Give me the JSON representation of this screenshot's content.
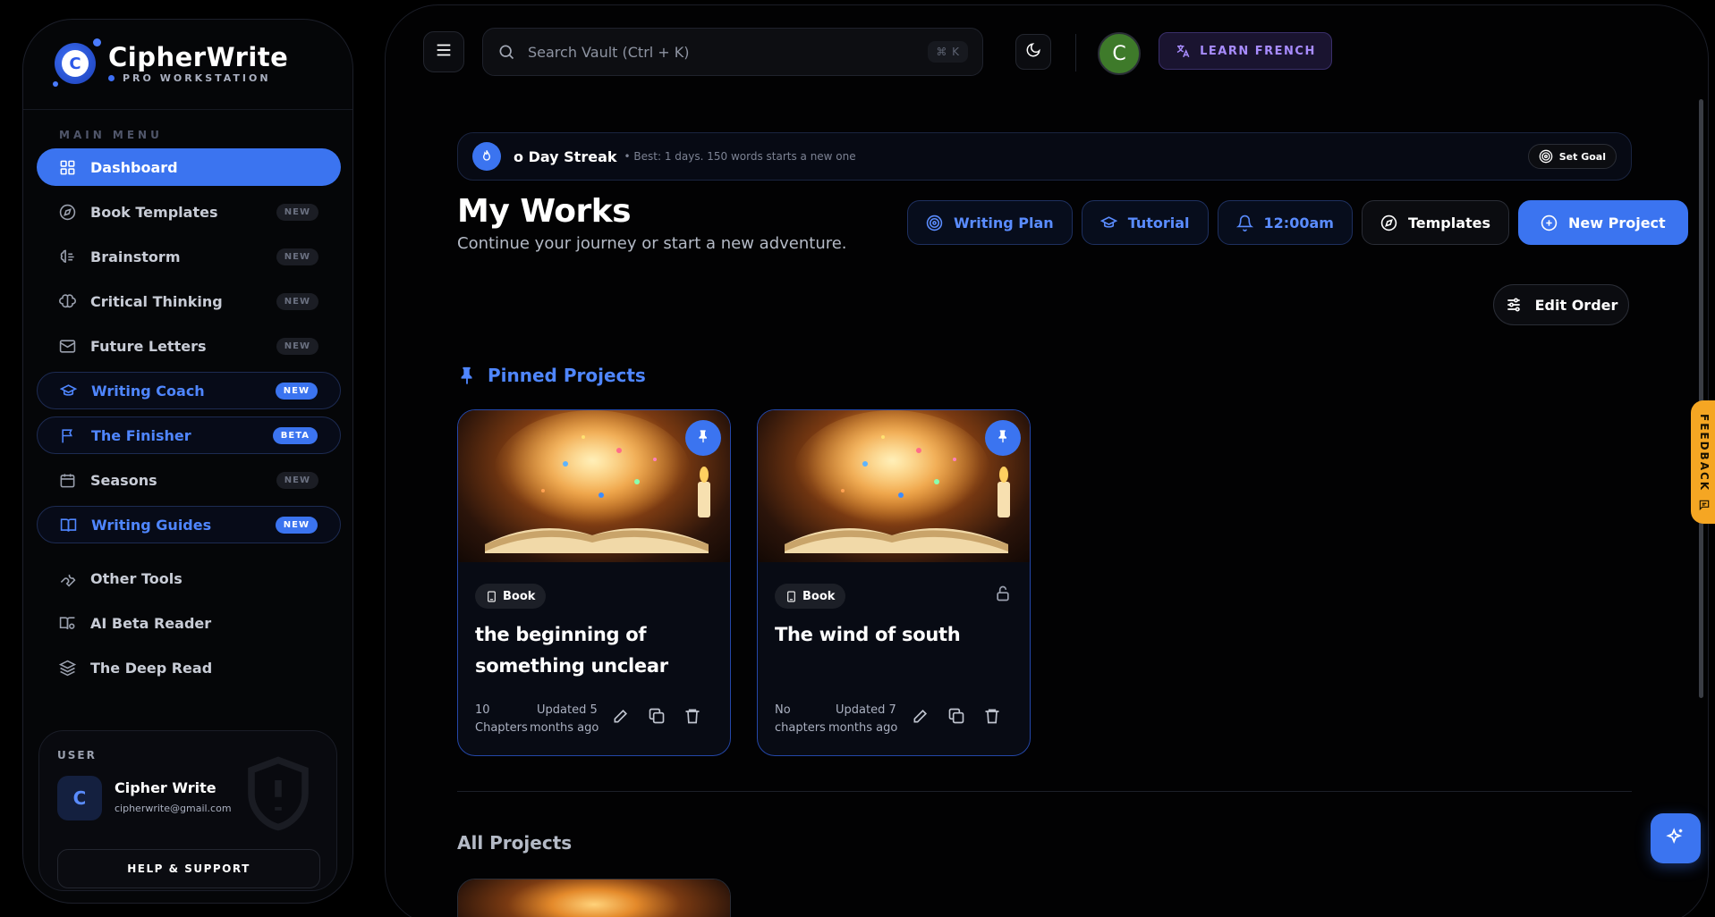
{
  "brand": {
    "title": "CipherWrite",
    "subtitle": "PRO WORKSTATION",
    "logo_letter": "C"
  },
  "sidebar": {
    "menu_label": "MAIN MENU",
    "items": [
      {
        "label": "Dashboard",
        "icon": "grid-icon",
        "badge": "",
        "state": "active"
      },
      {
        "label": "Book Templates",
        "icon": "compass-icon",
        "badge": "NEW",
        "state": "normal"
      },
      {
        "label": "Brainstorm",
        "icon": "brain-icon",
        "badge": "NEW",
        "state": "normal"
      },
      {
        "label": "Critical Thinking",
        "icon": "brain-icon",
        "badge": "NEW",
        "state": "normal"
      },
      {
        "label": "Future Letters",
        "icon": "mail-icon",
        "badge": "NEW",
        "state": "normal"
      },
      {
        "label": "Writing Coach",
        "icon": "graduation-cap-icon",
        "badge": "NEW",
        "state": "highlighted"
      },
      {
        "label": "The Finisher",
        "icon": "flag-icon",
        "badge": "BETA",
        "state": "highlighted"
      },
      {
        "label": "Seasons",
        "icon": "calendar-icon",
        "badge": "NEW",
        "state": "normal"
      },
      {
        "label": "Writing Guides",
        "icon": "book-open-icon",
        "badge": "NEW",
        "state": "highlighted"
      },
      {
        "label": "Other Tools",
        "icon": "wrench-icon",
        "badge": "",
        "state": "normal"
      },
      {
        "label": "AI Beta Reader",
        "icon": "book-search-icon",
        "badge": "",
        "state": "normal"
      },
      {
        "label": "The Deep Read",
        "icon": "layers-icon",
        "badge": "",
        "state": "normal"
      }
    ],
    "user": {
      "label": "USER",
      "initial": "C",
      "name": "Cipher Write",
      "email": "cipherwrite@gmail.com",
      "help_label": "HELP & SUPPORT"
    }
  },
  "topbar": {
    "search_placeholder": "Search Vault (Ctrl + K)",
    "search_shortcut": "⌘ K",
    "avatar_initial": "C",
    "learn_label": "LEARN FRENCH"
  },
  "streak": {
    "title": "o Day Streak",
    "desc": "• Best: 1 days. 150 words starts a new one",
    "goal_label": "Set Goal"
  },
  "page": {
    "title": "My Works",
    "subtitle": "Continue your journey or start a new adventure."
  },
  "actions": {
    "writing_plan": "Writing Plan",
    "tutorial": "Tutorial",
    "reminder": "12:00am",
    "templates": "Templates",
    "new_project": "New Project",
    "edit_order": "Edit Order"
  },
  "pinned": {
    "title": "Pinned Projects",
    "projects": [
      {
        "type": "Book",
        "title": "the beginning of something unclear",
        "chapters_line1": "10",
        "chapters_line2": "Chapters",
        "updated_line1": "Updated 5",
        "updated_line2": "months ago",
        "locked": false
      },
      {
        "type": "Book",
        "title": "The wind of south",
        "chapters_line1": "No",
        "chapters_line2": "chapters",
        "updated_line1": "Updated 7",
        "updated_line2": "months ago",
        "locked": true
      }
    ]
  },
  "all_projects": {
    "title": "All Projects"
  },
  "feedback": {
    "label": "FEEDBACK"
  },
  "colors": {
    "accent": "#3b74f0",
    "accent_text": "#4f86ff",
    "feedback": "#f5a623",
    "learn": "#a88cff"
  }
}
